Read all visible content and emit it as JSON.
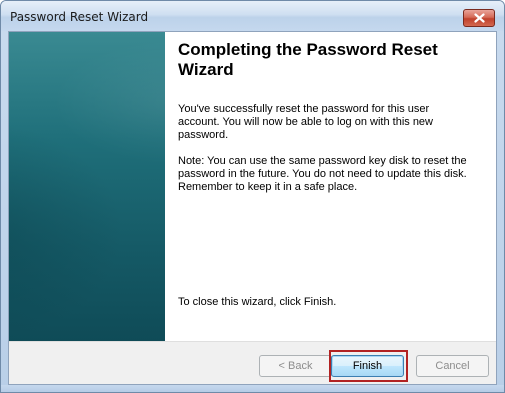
{
  "window": {
    "title": "Password Reset Wizard"
  },
  "main": {
    "heading": "Completing the Password Reset Wizard",
    "paragraph1": "You've successfully reset the password for this user account. You will now be able to log on with this new password.",
    "paragraph2": "Note: You can use the same password key disk to reset the password in the future. You do not need to update this disk. Remember to keep it in a safe place.",
    "closing": "To close this wizard, click Finish."
  },
  "buttons": {
    "back": "< Back",
    "finish": "Finish",
    "cancel": "Cancel"
  },
  "colors": {
    "side_panel": "#1f6f7a",
    "highlight": "#b22222",
    "close_button": "#c0412c"
  },
  "icons": {
    "close": "close-icon"
  }
}
